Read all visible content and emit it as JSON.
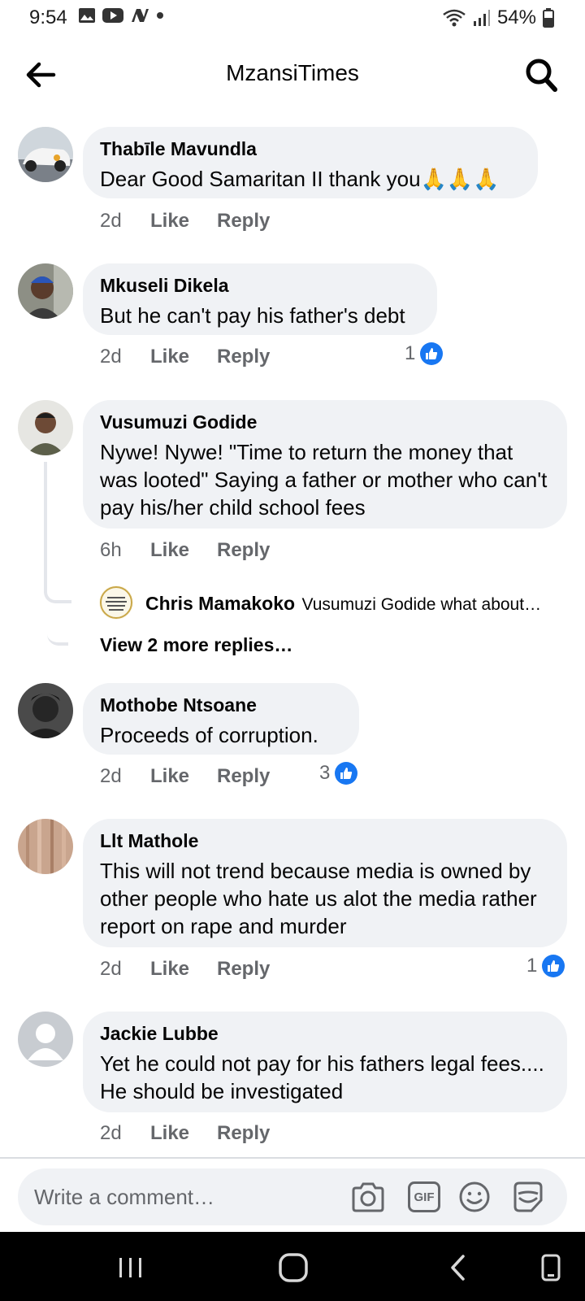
{
  "status_bar": {
    "time": "9:54",
    "battery": "54%"
  },
  "header": {
    "title": "MzansiTimes"
  },
  "comments": [
    {
      "author": "Thabīle Mavundla",
      "text": "Dear Good Samaritan  II thank you🙏🙏🙏",
      "age": "2d",
      "like_label": "Like",
      "reply_label": "Reply"
    },
    {
      "author": "Mkuseli Dikela",
      "text": "But he can't pay his father's debt",
      "age": "2d",
      "like_label": "Like",
      "reply_label": "Reply",
      "reactions": "1"
    },
    {
      "author": "Vusumuzi Godide",
      "text": "Nywe! Nywe! \"Time to return the money that was looted\" Saying a father or mother who can't pay his/her child school fees",
      "age": "6h",
      "like_label": "Like",
      "reply_label": "Reply"
    },
    {
      "author": "Mothobe Ntsoane",
      "text": "Proceeds of corruption.",
      "age": "2d",
      "like_label": "Like",
      "reply_label": "Reply",
      "reactions": "3"
    },
    {
      "author": "Llt Mathole",
      "text": "This will not trend because media is owned by other people who hate us alot the media rather report on rape and murder",
      "age": "2d",
      "like_label": "Like",
      "reply_label": "Reply",
      "reactions": "1"
    },
    {
      "author": "Jackie Lubbe",
      "text": "Yet he could not pay for his fathers legal fees.... He should be investigated",
      "age": "2d",
      "like_label": "Like",
      "reply_label": "Reply"
    }
  ],
  "reply_preview": {
    "author": "Chris Mamakoko",
    "text": "Vusumuzi Godide what about…"
  },
  "view_more_replies": "View 2 more replies…",
  "composer": {
    "placeholder": "Write a comment…",
    "gif_label": "GIF"
  },
  "colors": {
    "like_blue": "#1877f2",
    "bubble_bg": "#f0f2f5",
    "secondary_text": "#65676b"
  },
  "icons": [
    "back-arrow-icon",
    "search-icon",
    "like-reaction-icon",
    "camera-icon",
    "gif-icon",
    "emoji-icon",
    "sticker-icon"
  ]
}
